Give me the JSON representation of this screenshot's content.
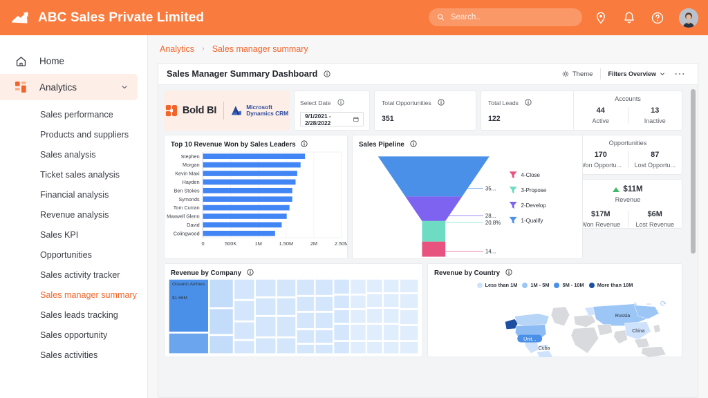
{
  "header": {
    "brand_title": "ABC Sales Private Limited",
    "logo_icon": "trending-up-chart-icon",
    "search": {
      "placeholder": "Search..",
      "value": "",
      "icon": "search-icon"
    },
    "icons": [
      {
        "name": "location-pin-icon"
      },
      {
        "name": "bell-notification-icon"
      },
      {
        "name": "help-circle-icon"
      }
    ],
    "avatar": {
      "name": "user-avatar",
      "alt": "User profile photo"
    },
    "background_color": "#f97b3d"
  },
  "sidebar": {
    "home": {
      "label": "Home",
      "icon": "home-icon"
    },
    "analytics": {
      "label": "Analytics",
      "icon": "grid-dashboard-icon",
      "chevron": "chevron-down-icon",
      "active": true
    },
    "items": [
      {
        "label": "Sales performance"
      },
      {
        "label": "Products and suppliers"
      },
      {
        "label": "Sales analysis"
      },
      {
        "label": "Ticket sales analysis"
      },
      {
        "label": "Financial analysis"
      },
      {
        "label": "Revenue analysis"
      },
      {
        "label": "Sales KPI"
      },
      {
        "label": "Opportunities"
      },
      {
        "label": "Sales activity tracker"
      },
      {
        "label": "Sales manager summary"
      },
      {
        "label": "Sales leads tracking"
      },
      {
        "label": "Sales opportunity"
      },
      {
        "label": "Sales activities"
      }
    ],
    "selected_label": "Sales manager summary",
    "accent_color": "#f2652a"
  },
  "breadcrumb": {
    "root": "Analytics",
    "separator": "›",
    "current": "Sales manager summary"
  },
  "dashboard": {
    "title": "Sales Manager Summary Dashboard",
    "theme_button": {
      "label": "Theme",
      "icon": "theme-gear-icon"
    },
    "filters_button": {
      "label": "Filters Overview",
      "icon": "chevron-down-icon"
    },
    "more_button": {
      "label": "…",
      "icon": "more-horizontal-icon"
    }
  },
  "brand_card": {
    "boldbi_label": "Bold BI",
    "ms_line1": "Microsoft",
    "ms_line2": "Dynamics CRM"
  },
  "select_date": {
    "label": "Select Date",
    "value": "9/1/2021 - 2/28/2022",
    "icon": "calendar-icon"
  },
  "kpis": [
    {
      "label": "Total Opportunities",
      "value": "351"
    },
    {
      "label": "Total Leads",
      "value": "122"
    }
  ],
  "stats": {
    "accounts": {
      "title": "Accounts",
      "left": {
        "value": "44",
        "caption": "Active"
      },
      "right": {
        "value": "13",
        "caption": "Inactive"
      }
    },
    "opportunities": {
      "title": "Opportunities",
      "left": {
        "value": "170",
        "caption": "Won Opportu..."
      },
      "right": {
        "value": "87",
        "caption": "Lost Opportu..."
      }
    },
    "revenue": {
      "total": "$11M",
      "total_caption": "Revenue",
      "trend_icon": "triangle-up-icon",
      "trend_color": "#3fb96b",
      "left": {
        "value": "$17M",
        "caption": "Won Revenue"
      },
      "right": {
        "value": "$6M",
        "caption": "Lost Revenue"
      }
    }
  },
  "chart_data": [
    {
      "type": "bar",
      "title": "Top 10 Revenue Won by Sales Leaders",
      "orientation": "horizontal",
      "categories": [
        "Stephen",
        "Morgan",
        "Kevin Maxi",
        "Hayden",
        "Ben Stokes",
        "Symonds",
        "Tom Curran",
        "Maxwell Glenn",
        "David",
        "Colingwood"
      ],
      "values": [
        1840000,
        1760000,
        1700000,
        1670000,
        1610000,
        1610000,
        1560000,
        1510000,
        1420000,
        1300000
      ],
      "xlabel": "",
      "ylabel": "",
      "xlim": [
        0,
        2500000
      ],
      "xticks": [
        "0",
        "500K",
        "1M",
        "1.50M",
        "2M",
        "2.50M"
      ],
      "xtick_values": [
        0,
        500000,
        1000000,
        1500000,
        2000000,
        2500000
      ],
      "series_color": "#4285f4",
      "grid": true,
      "legend": "none"
    },
    {
      "type": "funnel",
      "title": "Sales Pipeline",
      "stages": [
        {
          "label": "1-Qualify",
          "data_label": "35...",
          "percent": 35.0,
          "color": "#4a90e8"
        },
        {
          "label": "2-Develop",
          "data_label": "28...",
          "percent": 28.0,
          "color": "#7d63ef"
        },
        {
          "label": "3-Propose",
          "data_label": "20.8%",
          "percent": 20.8,
          "color": "#6ddcc3"
        },
        {
          "label": "4-Close",
          "data_label": "14...",
          "percent": 14.0,
          "color": "#e8527f"
        }
      ],
      "legend": [
        "4-Close",
        "3-Propose",
        "2-Develop",
        "1-Qualify"
      ],
      "legend_position": "right",
      "legend_icon": "funnel-icon"
    },
    {
      "type": "treemap",
      "title": "Revenue by Company",
      "largest_tile": {
        "name": "Oceanic Airlines",
        "value_label": "$1.66M"
      },
      "tile_color_max": "#4a90e8",
      "tile_color_min": "#d6e6fa"
    },
    {
      "type": "map",
      "title": "Revenue by Country",
      "legend": [
        {
          "label": "Less than 1M",
          "color": "#cfe2fb"
        },
        {
          "label": "1M - 5M",
          "color": "#9bc6f5"
        },
        {
          "label": "5M - 10M",
          "color": "#4a90e8"
        },
        {
          "label": "More than 10M",
          "color": "#1d4fa0"
        }
      ],
      "country_labels": [
        "Unit...",
        "Cuba",
        "Russia",
        "China"
      ],
      "controls": [
        {
          "name": "zoom-in",
          "glyph": "+"
        },
        {
          "name": "zoom-out",
          "glyph": "−"
        },
        {
          "name": "reset-zoom",
          "glyph": "⟳"
        }
      ]
    }
  ]
}
